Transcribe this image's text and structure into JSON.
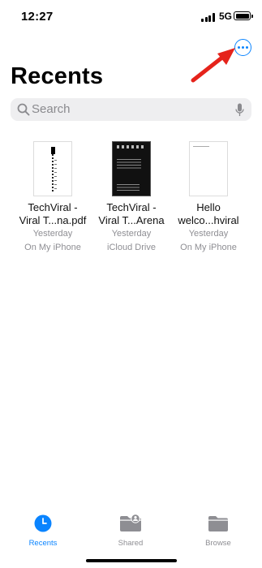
{
  "status": {
    "time": "12:27",
    "network": "5G"
  },
  "page": {
    "title": "Recents"
  },
  "search": {
    "placeholder": "Search"
  },
  "files": [
    {
      "name_line1": "TechViral -",
      "name_line2": "Viral T...na.pdf",
      "date": "Yesterday",
      "location": "On My iPhone"
    },
    {
      "name_line1": "TechViral -",
      "name_line2": "Viral T...Arena",
      "date": "Yesterday",
      "location": "iCloud Drive"
    },
    {
      "name_line1": "Hello",
      "name_line2": "welco...hviral",
      "date": "Yesterday",
      "location": "On My iPhone"
    }
  ],
  "tabs": [
    {
      "label": "Recents",
      "active": true,
      "icon": "clock-icon"
    },
    {
      "label": "Shared",
      "active": false,
      "icon": "shared-folder-icon"
    },
    {
      "label": "Browse",
      "active": false,
      "icon": "folder-icon"
    }
  ],
  "colors": {
    "accent": "#0a84ff",
    "annotation": "#e5231b",
    "inactive": "#8e8e93"
  }
}
